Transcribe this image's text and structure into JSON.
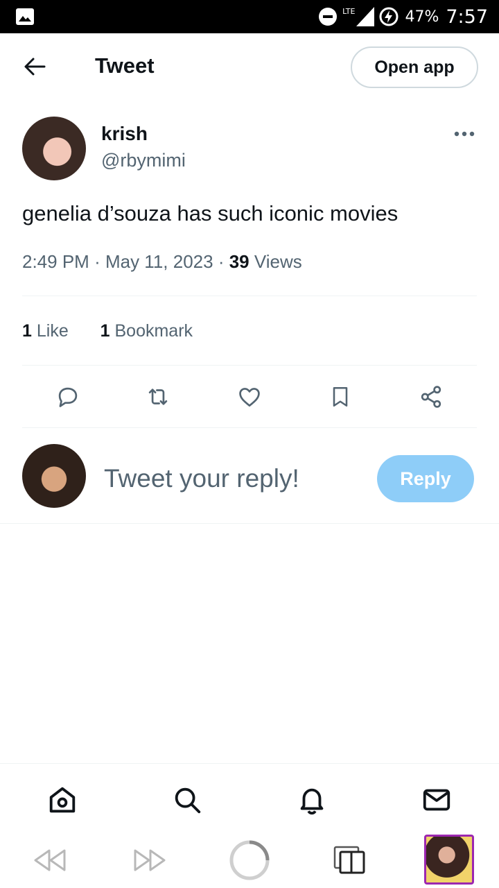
{
  "status_bar": {
    "network": "LTE",
    "battery": "47%",
    "time": "7:57"
  },
  "header": {
    "title": "Tweet",
    "open_app_label": "Open app"
  },
  "tweet": {
    "author_name": "krish",
    "author_handle": "@rbymimi",
    "text": "genelia d’souza has such iconic movies",
    "time": "2:49 PM",
    "date": "May 11, 2023",
    "views_count": "39",
    "views_label": "Views",
    "likes_count": "1",
    "likes_label": "Like",
    "bookmarks_count": "1",
    "bookmarks_label": "Bookmark"
  },
  "reply": {
    "placeholder": "Tweet your reply!",
    "button_label": "Reply"
  },
  "icons": {
    "actions": [
      "reply-icon",
      "retweet-icon",
      "like-icon",
      "bookmark-icon",
      "share-icon"
    ],
    "bottom_nav": [
      "home-icon",
      "search-icon",
      "notifications-icon",
      "messages-icon"
    ],
    "browser": [
      "rewind-icon",
      "fast-forward-icon",
      "loading-icon",
      "tabs-icon"
    ]
  },
  "colors": {
    "text_primary": "#0f1419",
    "text_secondary": "#536471",
    "reply_button": "#8ecdf8",
    "divider": "#eff3f4"
  }
}
